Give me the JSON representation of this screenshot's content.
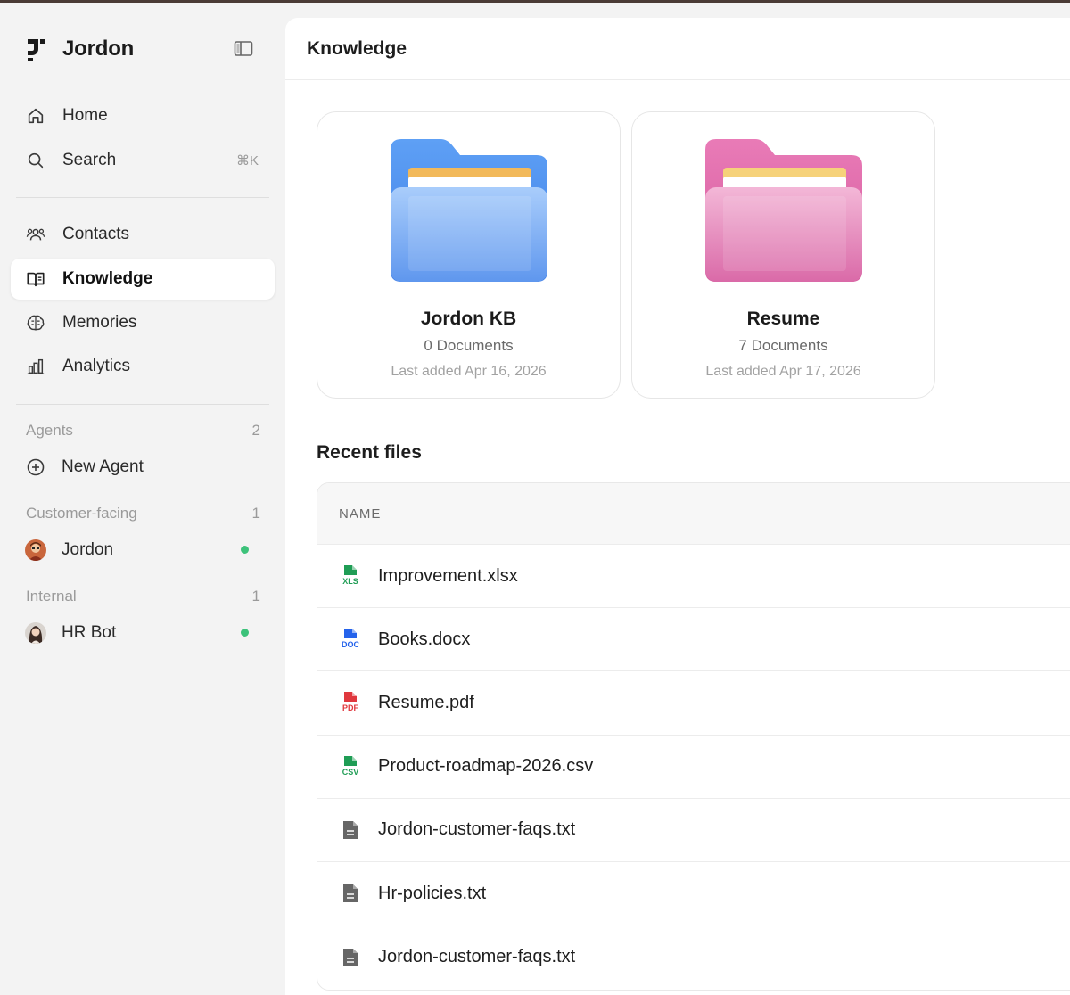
{
  "sidebar": {
    "brand": "Jordon",
    "nav": [
      {
        "label": "Home",
        "icon": "home-icon"
      },
      {
        "label": "Search",
        "icon": "search-icon",
        "shortcut": "⌘K"
      },
      {
        "label": "Contacts",
        "icon": "contacts-icon"
      },
      {
        "label": "Knowledge",
        "icon": "book-icon",
        "active": true
      },
      {
        "label": "Memories",
        "icon": "brain-icon"
      },
      {
        "label": "Analytics",
        "icon": "bar-chart-icon"
      }
    ],
    "agents": {
      "label": "Agents",
      "count": "2",
      "new_agent": "New Agent",
      "groups": [
        {
          "label": "Customer-facing",
          "count": "1",
          "agent": "Jordon",
          "status": "online"
        },
        {
          "label": "Internal",
          "count": "1",
          "agent": "HR Bot",
          "status": "online"
        }
      ]
    }
  },
  "main": {
    "title": "Knowledge",
    "knowledge_bases": [
      {
        "name": "Jordon KB",
        "docs": "0 Documents",
        "last_added": "Last added Apr 16, 2026",
        "color": "blue"
      },
      {
        "name": "Resume",
        "docs": "7 Documents",
        "last_added": "Last added Apr 17, 2026",
        "color": "pink"
      }
    ],
    "recent_title": "Recent files",
    "table_header": "NAME",
    "files": [
      {
        "name": "Improvement.xlsx",
        "type": "XLS",
        "color": "#1f9d55"
      },
      {
        "name": "Books.docx",
        "type": "DOC",
        "color": "#2563eb"
      },
      {
        "name": "Resume.pdf",
        "type": "PDF",
        "color": "#e0383e"
      },
      {
        "name": "Product-roadmap-2026.csv",
        "type": "CSV",
        "color": "#1f9d55"
      },
      {
        "name": "Jordon-customer-faqs.txt",
        "type": "TXT",
        "color": "#666666"
      },
      {
        "name": "Hr-policies.txt",
        "type": "TXT",
        "color": "#666666"
      },
      {
        "name": "Jordon-customer-faqs.txt",
        "type": "TXT",
        "color": "#666666"
      }
    ]
  }
}
